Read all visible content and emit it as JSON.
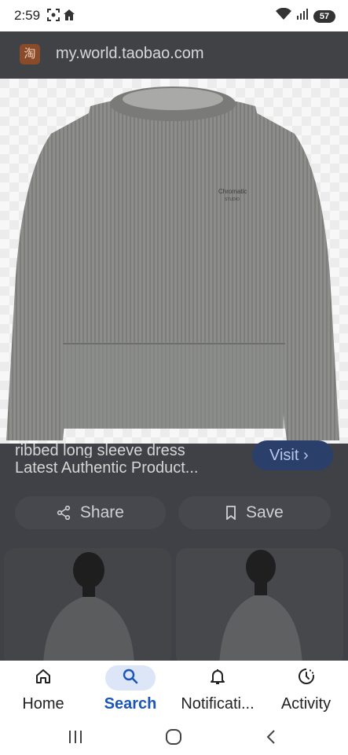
{
  "status_bar": {
    "time": "2:59",
    "battery": "57",
    "left_icons": [
      "screenshot-icon",
      "home-status-icon"
    ],
    "right_icons": [
      "wifi-icon",
      "signal-icon",
      "battery-icon"
    ]
  },
  "browser": {
    "site_icon_glyph": "淘",
    "url": "my.world.taobao.com"
  },
  "product": {
    "image_alt": "grey ribbed crewneck sweatshirt",
    "sweater_print_line1": "Chromatic",
    "sweater_print_line2": "STUDIO",
    "title_line1": "ribbed long sleeve dress",
    "title_line2": "Latest Authentic Product...",
    "visit_label": "Visit",
    "visit_chevron": "›"
  },
  "actions": {
    "share_label": "Share",
    "save_label": "Save"
  },
  "bottom_nav": {
    "items": [
      {
        "label": "Home",
        "icon": "home-icon",
        "selected": false
      },
      {
        "label": "Search",
        "icon": "search-icon",
        "selected": true
      },
      {
        "label": "Notificati...",
        "icon": "bell-icon",
        "selected": false
      },
      {
        "label": "Activity",
        "icon": "activity-icon",
        "selected": false
      }
    ]
  },
  "colors": {
    "accent": "#1a56b8",
    "selected_pill": "#dce6f7",
    "scrim": "#3f4146"
  }
}
